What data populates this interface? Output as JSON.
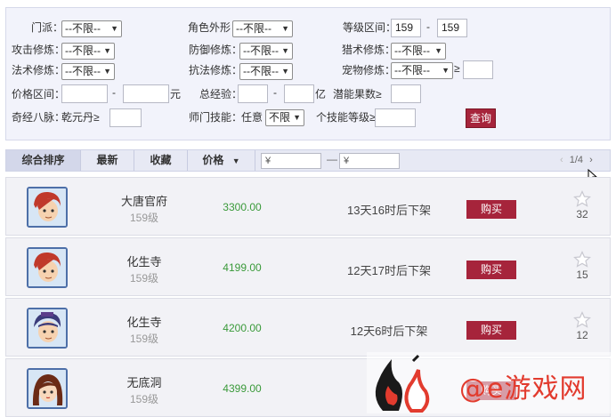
{
  "filters": {
    "sect_label": "门派：",
    "appearance_label": "角色外形：",
    "level_range_label": "等级区间：",
    "level_min": "159",
    "level_max": "159",
    "range_dash": "-",
    "attack_cult_label": "攻击修炼：",
    "defense_cult_label": "防御修炼：",
    "hunting_cult_label": "猎术修炼：",
    "magic_cult_label": "法术修炼：",
    "resist_cult_label": "抗法修炼：",
    "pet_cult_label": "宠物修炼：",
    "gte_symbol": "≥",
    "price_range_label": "价格区间：",
    "price_unit": "元",
    "total_exp_label": "总经验：",
    "exp_unit": "亿",
    "potential_fruit_label": "潜能果数≥",
    "meridian_label": "奇经八脉：",
    "meridian_item": "乾元丹≥",
    "school_skill_label": "师门技能：",
    "any_label": "任意",
    "skill_count_option": "不限",
    "skill_level_label": "个技能等级≥",
    "unlimited_option": "--不限--",
    "search_button": "查询"
  },
  "sort_bar": {
    "tabs": [
      "综合排序",
      "最新",
      "收藏",
      "价格"
    ],
    "price_from_placeholder": "¥",
    "price_to_placeholder": "¥",
    "range_dash": "—",
    "page_indicator": "1/4",
    "prev_icon": "chevron-left-icon",
    "next_icon": "chevron-right-icon"
  },
  "items": [
    {
      "sect": "大唐官府",
      "level": "159级",
      "price": "3300.00",
      "time_left": "13天16时后下架",
      "buy": "购买",
      "favorites": "32"
    },
    {
      "sect": "化生寺",
      "level": "159级",
      "price": "4199.00",
      "time_left": "12天17时后下架",
      "buy": "购买",
      "favorites": "15"
    },
    {
      "sect": "化生寺",
      "level": "159级",
      "price": "4200.00",
      "time_left": "12天6时后下架",
      "buy": "购买",
      "favorites": "12"
    },
    {
      "sect": "无底洞",
      "level": "159级",
      "price": "4399.00",
      "time_left": "12天",
      "buy": "购买",
      "favorites": ""
    }
  ],
  "watermark": {
    "text": "@e游戏网"
  },
  "colors": {
    "accent_red": "#a6243b",
    "price_green": "#3a9a3a",
    "panel_bg": "#f2f3fb"
  }
}
